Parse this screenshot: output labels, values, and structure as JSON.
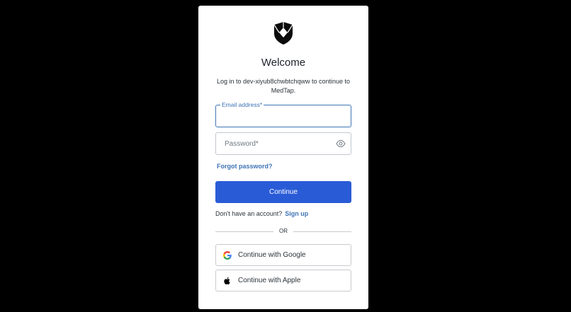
{
  "login": {
    "title": "Welcome",
    "subtitle": "Log in to dev-xiyub8chwbtchqww to continue to MedTap.",
    "email_label": "Email address*",
    "email_value": "",
    "password_placeholder": "Password*",
    "forgot_password": "Forgot password?",
    "continue_label": "Continue",
    "no_account_text": "Don't have an account?",
    "signup_label": "Sign up",
    "divider_text": "OR",
    "google_label": "Continue with Google",
    "apple_label": "Continue with Apple"
  },
  "icons": {
    "logo": "shield-logo-icon",
    "password_toggle": "eye-icon",
    "google": "google-icon",
    "apple": "apple-icon"
  },
  "colors": {
    "background": "#000000",
    "card": "#ffffff",
    "primary_button": "#2a5bd7",
    "link": "#3f73b5",
    "focus_border": "#3f73b5"
  }
}
